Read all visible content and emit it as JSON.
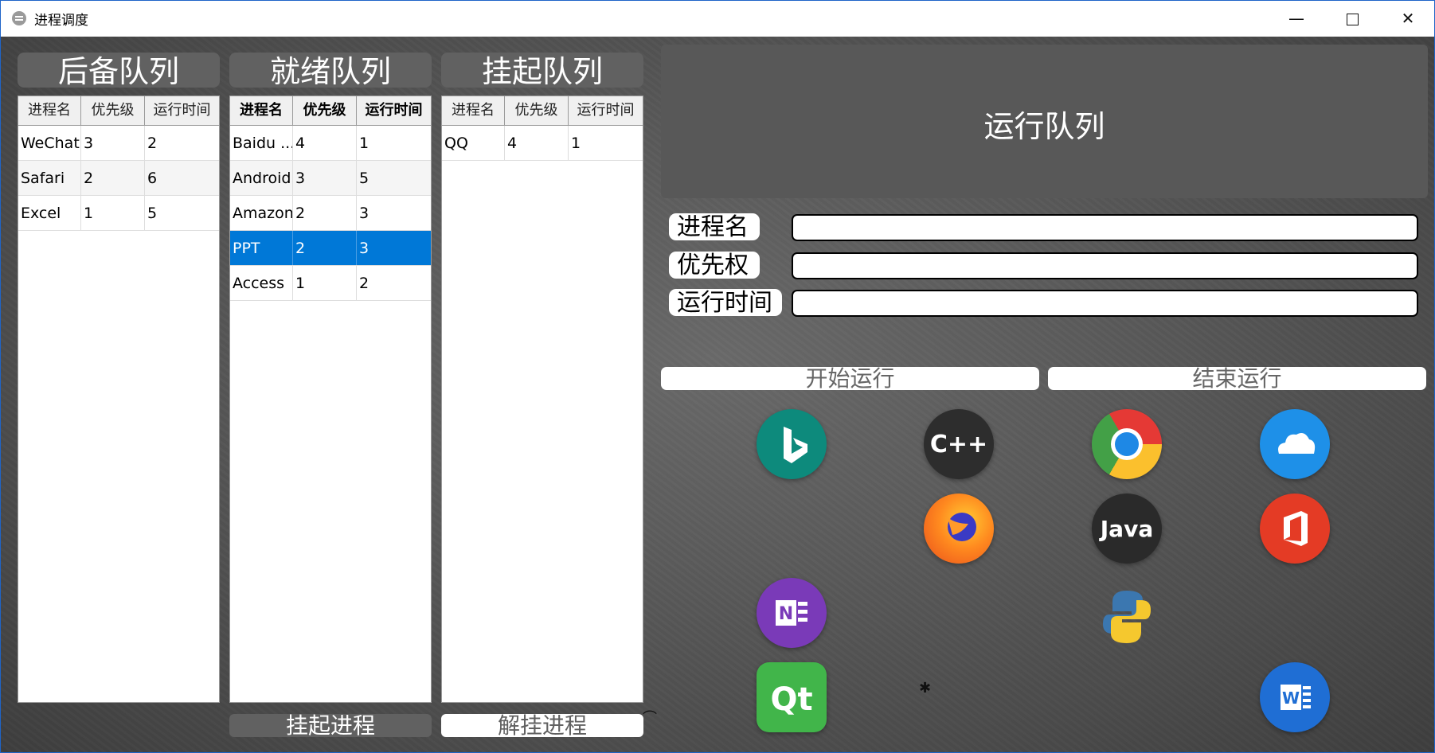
{
  "window": {
    "title": "进程调度",
    "minimize_glyph": "—",
    "close_glyph": "✕"
  },
  "backup_queue": {
    "title": "后备队列",
    "columns": [
      "进程名",
      "优先级",
      "运行时间"
    ],
    "rows": [
      [
        "WeChat",
        "3",
        "2"
      ],
      [
        "Safari",
        "2",
        "6"
      ],
      [
        "Excel",
        "1",
        "5"
      ]
    ]
  },
  "ready_queue": {
    "title": "就绪队列",
    "columns": [
      "进程名",
      "优先级",
      "运行时间"
    ],
    "rows": [
      [
        "Baidu ...",
        "4",
        "1"
      ],
      [
        "Android",
        "3",
        "5"
      ],
      [
        "Amazon",
        "2",
        "3"
      ],
      [
        "PPT",
        "2",
        "3"
      ],
      [
        "Access",
        "1",
        "2"
      ]
    ],
    "selected_row": 3
  },
  "suspend_queue": {
    "title": "挂起队列",
    "columns": [
      "进程名",
      "优先级",
      "运行时间"
    ],
    "rows": [
      [
        "QQ",
        "4",
        "1"
      ]
    ]
  },
  "buttons": {
    "suspend": "挂起进程",
    "resume": "解挂进程",
    "start": "开始运行",
    "stop": "结束运行"
  },
  "run_queue": {
    "title": "运行队列",
    "labels": {
      "name": "进程名",
      "priority": "优先权",
      "runtime": "运行时间"
    },
    "values": {
      "name": "",
      "priority": "",
      "runtime": ""
    }
  },
  "app_icons": {
    "cpp_text": "C++",
    "java_text": "Java",
    "qt_text": "Qt",
    "onenote_text": "N",
    "word_text": "W",
    "names": [
      "bing-icon",
      "cpp-icon",
      "chrome-icon",
      "onedrive-icon",
      "firefox-icon",
      "java-icon",
      "office-icon",
      "onenote-icon",
      "python-icon",
      "qt-icon",
      "word-icon"
    ]
  },
  "colors": {
    "selection": "#0078d7",
    "panel": "#616161",
    "background": "#555555"
  }
}
